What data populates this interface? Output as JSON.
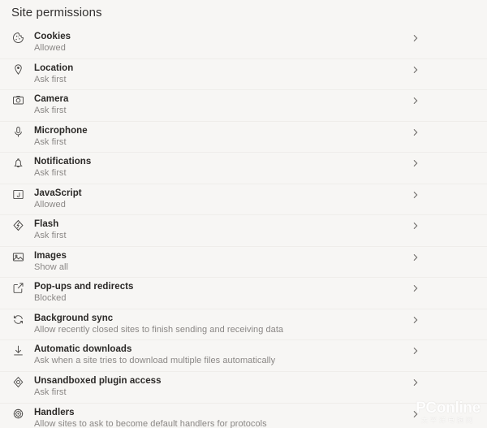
{
  "header": {
    "title": "Site permissions"
  },
  "theme": {
    "background": "#f7f6f4",
    "title_color": "#333130",
    "label_color": "#2b2927",
    "sub_color": "#8a8785",
    "icon_color": "#4a4846",
    "divider_color": "#efedea",
    "chevron_color": "#6f6c69"
  },
  "permissions": {
    "items": [
      {
        "label": "Cookies",
        "status": "Allowed",
        "icon": "cookie-icon",
        "chevron": "chevron-right-icon"
      },
      {
        "label": "Location",
        "status": "Ask first",
        "icon": "location-pin-icon",
        "chevron": "chevron-right-icon"
      },
      {
        "label": "Camera",
        "status": "Ask first",
        "icon": "camera-icon",
        "chevron": "chevron-right-icon"
      },
      {
        "label": "Microphone",
        "status": "Ask first",
        "icon": "microphone-icon",
        "chevron": "chevron-right-icon"
      },
      {
        "label": "Notifications",
        "status": "Ask first",
        "icon": "bell-icon",
        "chevron": "chevron-right-icon"
      },
      {
        "label": "JavaScript",
        "status": "Allowed",
        "icon": "javascript-code-icon",
        "chevron": "chevron-right-icon"
      },
      {
        "label": "Flash",
        "status": "Ask first",
        "icon": "flash-icon",
        "chevron": "chevron-right-icon"
      },
      {
        "label": "Images",
        "status": "Show all",
        "icon": "image-icon",
        "chevron": "chevron-right-icon"
      },
      {
        "label": "Pop-ups and redirects",
        "status": "Blocked",
        "icon": "external-link-icon",
        "chevron": "chevron-right-icon"
      },
      {
        "label": "Background sync",
        "status": "Allow recently closed sites to finish sending and receiving data",
        "icon": "sync-icon",
        "chevron": "chevron-right-icon"
      },
      {
        "label": "Automatic downloads",
        "status": "Ask when a site tries to download multiple files automatically",
        "icon": "download-icon",
        "chevron": "chevron-right-icon"
      },
      {
        "label": "Unsandboxed plugin access",
        "status": "Ask first",
        "icon": "plugin-icon",
        "chevron": "chevron-right-icon"
      },
      {
        "label": "Handlers",
        "status": "Allow sites to ask to become default handlers for protocols",
        "icon": "handlers-gear-icon",
        "chevron": "chevron-right-icon"
      }
    ]
  },
  "watermark": {
    "main": "PConline",
    "sub": "太平洋电脑网"
  }
}
